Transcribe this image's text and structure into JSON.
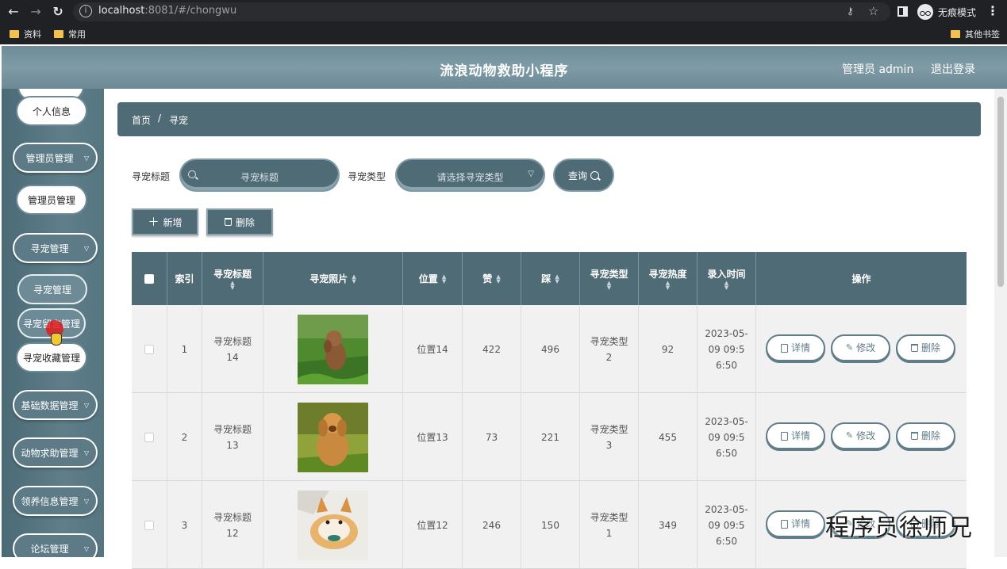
{
  "browser": {
    "url_host": "localhost",
    "url_rest": ":8081/#/chongwu",
    "incognito_label": "无痕模式",
    "bookmarks": [
      "资料",
      "常用"
    ],
    "other_bookmarks": "其他书签"
  },
  "header": {
    "title": "流浪动物救助小程序",
    "admin_label": "管理员 admin",
    "logout": "退出登录"
  },
  "sidebar": {
    "items": [
      {
        "label": "个人信息"
      },
      {
        "label": "管理员管理"
      },
      {
        "label": "管理员管理"
      },
      {
        "label": "寻宠管理"
      },
      {
        "label": "寻宠管理"
      },
      {
        "label": "寻宠留言管理"
      },
      {
        "label": "寻宠收藏管理"
      },
      {
        "label": "基础数据管理"
      },
      {
        "label": "动物求助管理"
      },
      {
        "label": "领养信息管理"
      },
      {
        "label": "论坛管理"
      }
    ]
  },
  "breadcrumb": {
    "home": "首页",
    "separator": "/",
    "current": "寻宠"
  },
  "filters": {
    "title_label": "寻宠标题",
    "title_placeholder": "寻宠标题",
    "type_label": "寻宠类型",
    "type_placeholder": "请选择寻宠类型",
    "query_button": "查询"
  },
  "actions": {
    "add": "新增",
    "delete": "删除"
  },
  "table": {
    "columns": [
      "索引",
      "寻宠标题",
      "寻宠照片",
      "位置",
      "赞",
      "踩",
      "寻宠类型",
      "寻宠热度",
      "录入时间",
      "操作"
    ],
    "rows": [
      {
        "index": "1",
        "title": "寻宠标题14",
        "location": "位置14",
        "likes": "422",
        "dislikes": "496",
        "type": "寻宠类型2",
        "heat": "92",
        "time": "2023-05-09 09:56:50",
        "photo": "poodle-on-grass"
      },
      {
        "index": "2",
        "title": "寻宠标题13",
        "location": "位置13",
        "likes": "73",
        "dislikes": "221",
        "type": "寻宠类型3",
        "heat": "455",
        "time": "2023-05-09 09:56:50",
        "photo": "golden-retriever"
      },
      {
        "index": "3",
        "title": "寻宠标题12",
        "location": "位置12",
        "likes": "246",
        "dislikes": "150",
        "type": "寻宠类型1",
        "heat": "349",
        "time": "2023-05-09 09:56:50",
        "photo": "shiba-inu"
      }
    ],
    "row_actions": {
      "detail": "详情",
      "edit": "修改",
      "delete": "删除"
    }
  },
  "watermark": "程序员徐师兄",
  "colors": {
    "primary": "#4f6b76",
    "header": "#7e9ba6",
    "sidebar": "#557581"
  }
}
